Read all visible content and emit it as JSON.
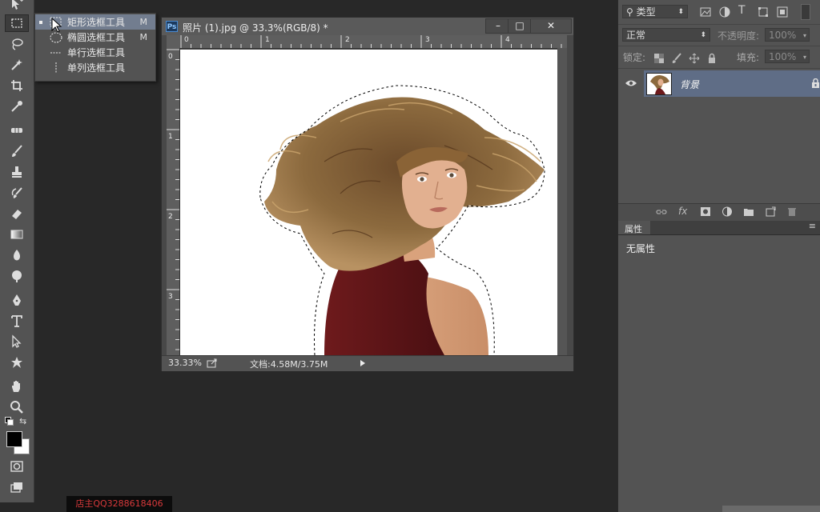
{
  "flyout": {
    "items": [
      {
        "label": "矩形选框工具",
        "key": "M",
        "icon": "rectangular-marquee-icon"
      },
      {
        "label": "椭圆选框工具",
        "key": "M",
        "icon": "elliptical-marquee-icon"
      },
      {
        "label": "单行选框工具",
        "key": "",
        "icon": "single-row-marquee-icon"
      },
      {
        "label": "单列选框工具",
        "key": "",
        "icon": "single-column-marquee-icon"
      }
    ]
  },
  "document": {
    "title": "照片 (1).jpg @ 33.3%(RGB/8) *",
    "app_badge": "Ps",
    "window_buttons": [
      "–",
      "□",
      "✕"
    ],
    "ruler_top_labels": [
      "0",
      "1",
      "2",
      "3",
      "4"
    ],
    "ruler_left_labels": [
      "0",
      "1",
      "2",
      "3"
    ],
    "zoom": "33.33%",
    "doc_size": "文档:4.58M/3.75M"
  },
  "layers_panel": {
    "filter_kind": "类型",
    "blend_mode": "正常",
    "opacity_label": "不透明度:",
    "opacity_value": "100%",
    "lock_label": "锁定:",
    "fill_label": "填充:",
    "fill_value": "100%",
    "layer_name": "背景"
  },
  "properties_panel": {
    "title": "属性",
    "body": "无属性"
  },
  "watermark": "店主QQ3288618406",
  "colors": {
    "panel": "#535353",
    "selected_layer": "#5f6d86",
    "flyout_selected": "#727d8f",
    "workspace": "#282828"
  }
}
